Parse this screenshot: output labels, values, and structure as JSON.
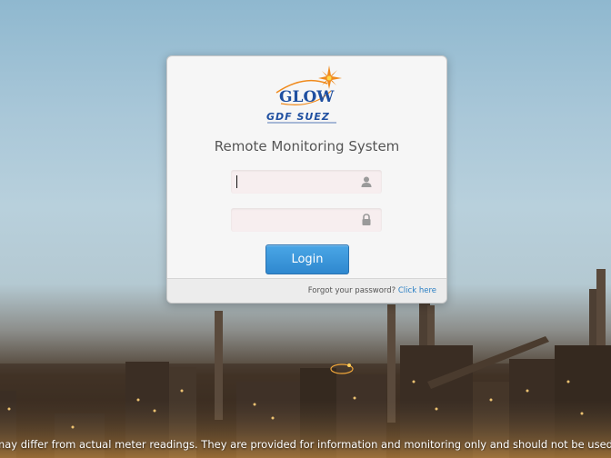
{
  "login": {
    "title": "Remote Monitoring System",
    "username": {
      "value": "",
      "icon": "user-icon"
    },
    "password": {
      "value": "",
      "icon": "lock-icon"
    },
    "login_label": "Login",
    "forgot_text": "Forgot your password?",
    "forgot_link": "Click here"
  },
  "logo": {
    "brand": "GLOW",
    "company": "GDF SUEZ"
  },
  "footer": {
    "disclaimer": "may differ from actual meter readings. They are provided for information and monitoring only and should not be used for invoices o"
  },
  "colors": {
    "accent": "#2f88cf",
    "link": "#2a7fc4",
    "brand_blue": "#1f4fa0",
    "brand_orange": "#f08a1c"
  }
}
